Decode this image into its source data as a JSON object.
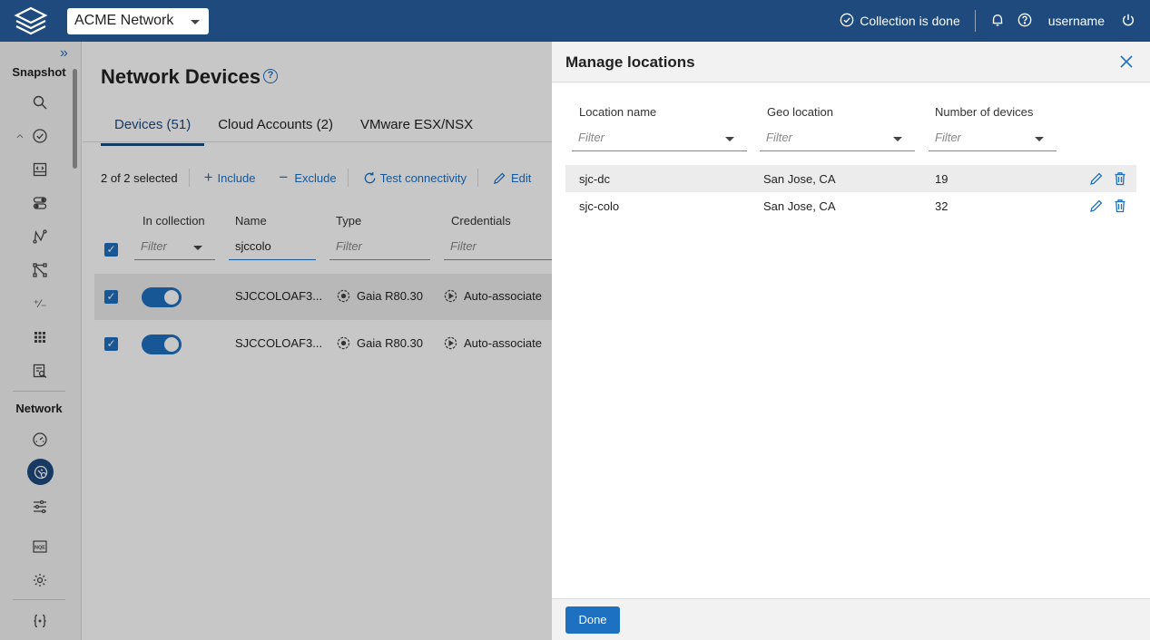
{
  "topbar": {
    "network": "ACME Network",
    "collection_status": "Collection is done",
    "username": "username",
    "icons": [
      "logo-icon",
      "check-circle-icon",
      "bell-icon",
      "help-icon",
      "power-icon"
    ]
  },
  "sidebar": {
    "snapshot_label": "Snapshot",
    "network_label": "Network",
    "collapse_glyph": "»",
    "plus_minus_glyph": "⁺⁄₋"
  },
  "main": {
    "title": "Network Devices",
    "tabs": [
      "Devices (51)",
      "Cloud Accounts (2)",
      "VMware ESX/NSX"
    ],
    "selection": "2 of 2 selected",
    "actions": [
      "Include",
      "Exclude",
      "Test connectivity",
      "Edit"
    ],
    "columns": [
      "In collection",
      "Name",
      "Type",
      "Credentials"
    ],
    "filter_placeholder": "Filter",
    "name_filter_value": "sjccolo",
    "rows": [
      {
        "name": "SJCCOLOAF3...",
        "type": "Gaia R80.30",
        "credentials": "Auto-associate"
      },
      {
        "name": "SJCCOLOAF3...",
        "type": "Gaia R80.30",
        "credentials": "Auto-associate"
      }
    ]
  },
  "panel": {
    "title": "Manage locations",
    "columns": [
      "Location name",
      "Geo location",
      "Number of devices"
    ],
    "filter_placeholder": "Filter",
    "rows": [
      {
        "name": "sjc-dc",
        "geo": "San Jose, CA",
        "devices": "19"
      },
      {
        "name": "sjc-colo",
        "geo": "San Jose, CA",
        "devices": "32"
      }
    ],
    "done_label": "Done"
  },
  "colors": {
    "topbar": "#1e4a7e",
    "accent": "#1e70c1"
  }
}
